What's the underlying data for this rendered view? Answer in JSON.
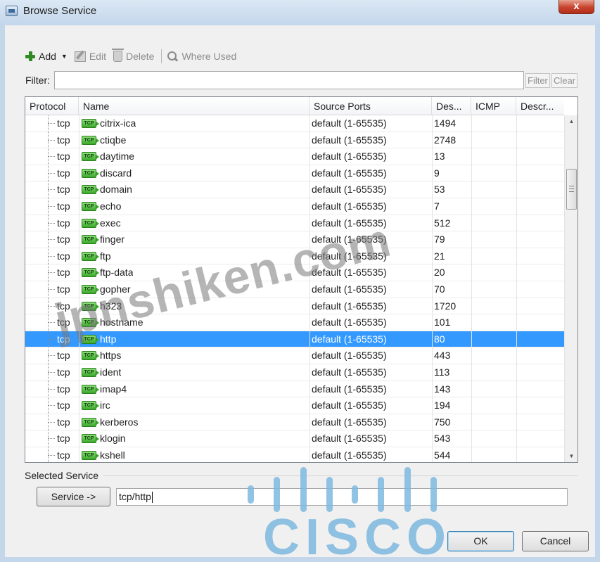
{
  "window": {
    "title": "Browse Service",
    "close_label": "x"
  },
  "toolbar": {
    "add_label": "Add",
    "edit_label": "Edit",
    "delete_label": "Delete",
    "where_used_label": "Where Used"
  },
  "filter": {
    "label": "Filter:",
    "value": "",
    "filter_button": "Filter",
    "clear_button": "Clear"
  },
  "grid": {
    "columns": [
      "Protocol",
      "Name",
      "Source Ports",
      "Des...",
      "ICMP",
      "Descr..."
    ],
    "icon_label": "TCP",
    "selected_index": 13,
    "rows": [
      {
        "protocol": "tcp",
        "name": "citrix-ica",
        "source_ports": "default (1-65535)",
        "dest": "1494"
      },
      {
        "protocol": "tcp",
        "name": "ctiqbe",
        "source_ports": "default (1-65535)",
        "dest": "2748"
      },
      {
        "protocol": "tcp",
        "name": "daytime",
        "source_ports": "default (1-65535)",
        "dest": "13"
      },
      {
        "protocol": "tcp",
        "name": "discard",
        "source_ports": "default (1-65535)",
        "dest": "9"
      },
      {
        "protocol": "tcp",
        "name": "domain",
        "source_ports": "default (1-65535)",
        "dest": "53"
      },
      {
        "protocol": "tcp",
        "name": "echo",
        "source_ports": "default (1-65535)",
        "dest": "7"
      },
      {
        "protocol": "tcp",
        "name": "exec",
        "source_ports": "default (1-65535)",
        "dest": "512"
      },
      {
        "protocol": "tcp",
        "name": "finger",
        "source_ports": "default (1-65535)",
        "dest": "79"
      },
      {
        "protocol": "tcp",
        "name": "ftp",
        "source_ports": "default (1-65535)",
        "dest": "21"
      },
      {
        "protocol": "tcp",
        "name": "ftp-data",
        "source_ports": "default (1-65535)",
        "dest": "20"
      },
      {
        "protocol": "tcp",
        "name": "gopher",
        "source_ports": "default (1-65535)",
        "dest": "70"
      },
      {
        "protocol": "tcp",
        "name": "h323",
        "source_ports": "default (1-65535)",
        "dest": "1720"
      },
      {
        "protocol": "tcp",
        "name": "hostname",
        "source_ports": "default (1-65535)",
        "dest": "101"
      },
      {
        "protocol": "tcp",
        "name": "http",
        "source_ports": "default (1-65535)",
        "dest": "80"
      },
      {
        "protocol": "tcp",
        "name": "https",
        "source_ports": "default (1-65535)",
        "dest": "443"
      },
      {
        "protocol": "tcp",
        "name": "ident",
        "source_ports": "default (1-65535)",
        "dest": "113"
      },
      {
        "protocol": "tcp",
        "name": "imap4",
        "source_ports": "default (1-65535)",
        "dest": "143"
      },
      {
        "protocol": "tcp",
        "name": "irc",
        "source_ports": "default (1-65535)",
        "dest": "194"
      },
      {
        "protocol": "tcp",
        "name": "kerberos",
        "source_ports": "default (1-65535)",
        "dest": "750"
      },
      {
        "protocol": "tcp",
        "name": "klogin",
        "source_ports": "default (1-65535)",
        "dest": "543"
      },
      {
        "protocol": "tcp",
        "name": "kshell",
        "source_ports": "default (1-65535)",
        "dest": "544"
      }
    ]
  },
  "selected_service": {
    "label": "Selected Service",
    "service_button": "Service ->",
    "value": "tcp/http"
  },
  "branding": {
    "cisco_text": "CISCO",
    "watermark": "jpnshiken.com"
  },
  "dialog": {
    "ok_label": "OK",
    "cancel_label": "Cancel"
  },
  "colors": {
    "selection": "#3399ff",
    "cisco_blue": "#7eb8e0",
    "tcp_icon_green": "#3aa92a"
  }
}
